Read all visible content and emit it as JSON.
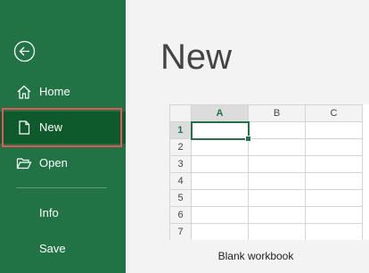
{
  "colors": {
    "sidebar": "#217346",
    "sidebar_selected": "#0e5a2d",
    "highlight_border": "#e8535a",
    "accent": "#217346"
  },
  "sidebar": {
    "back_icon": "back-arrow-circle-icon",
    "items": [
      {
        "label": "Home",
        "icon": "home-icon"
      },
      {
        "label": "New",
        "icon": "new-document-icon",
        "selected": true
      },
      {
        "label": "Open",
        "icon": "folder-open-icon"
      },
      {
        "label": "Info"
      },
      {
        "label": "Save"
      }
    ]
  },
  "main": {
    "title": "New",
    "template": {
      "caption": "Blank workbook",
      "columns": [
        "A",
        "B",
        "C"
      ],
      "rows": [
        "1",
        "2",
        "3",
        "4",
        "5",
        "6",
        "7"
      ]
    }
  }
}
